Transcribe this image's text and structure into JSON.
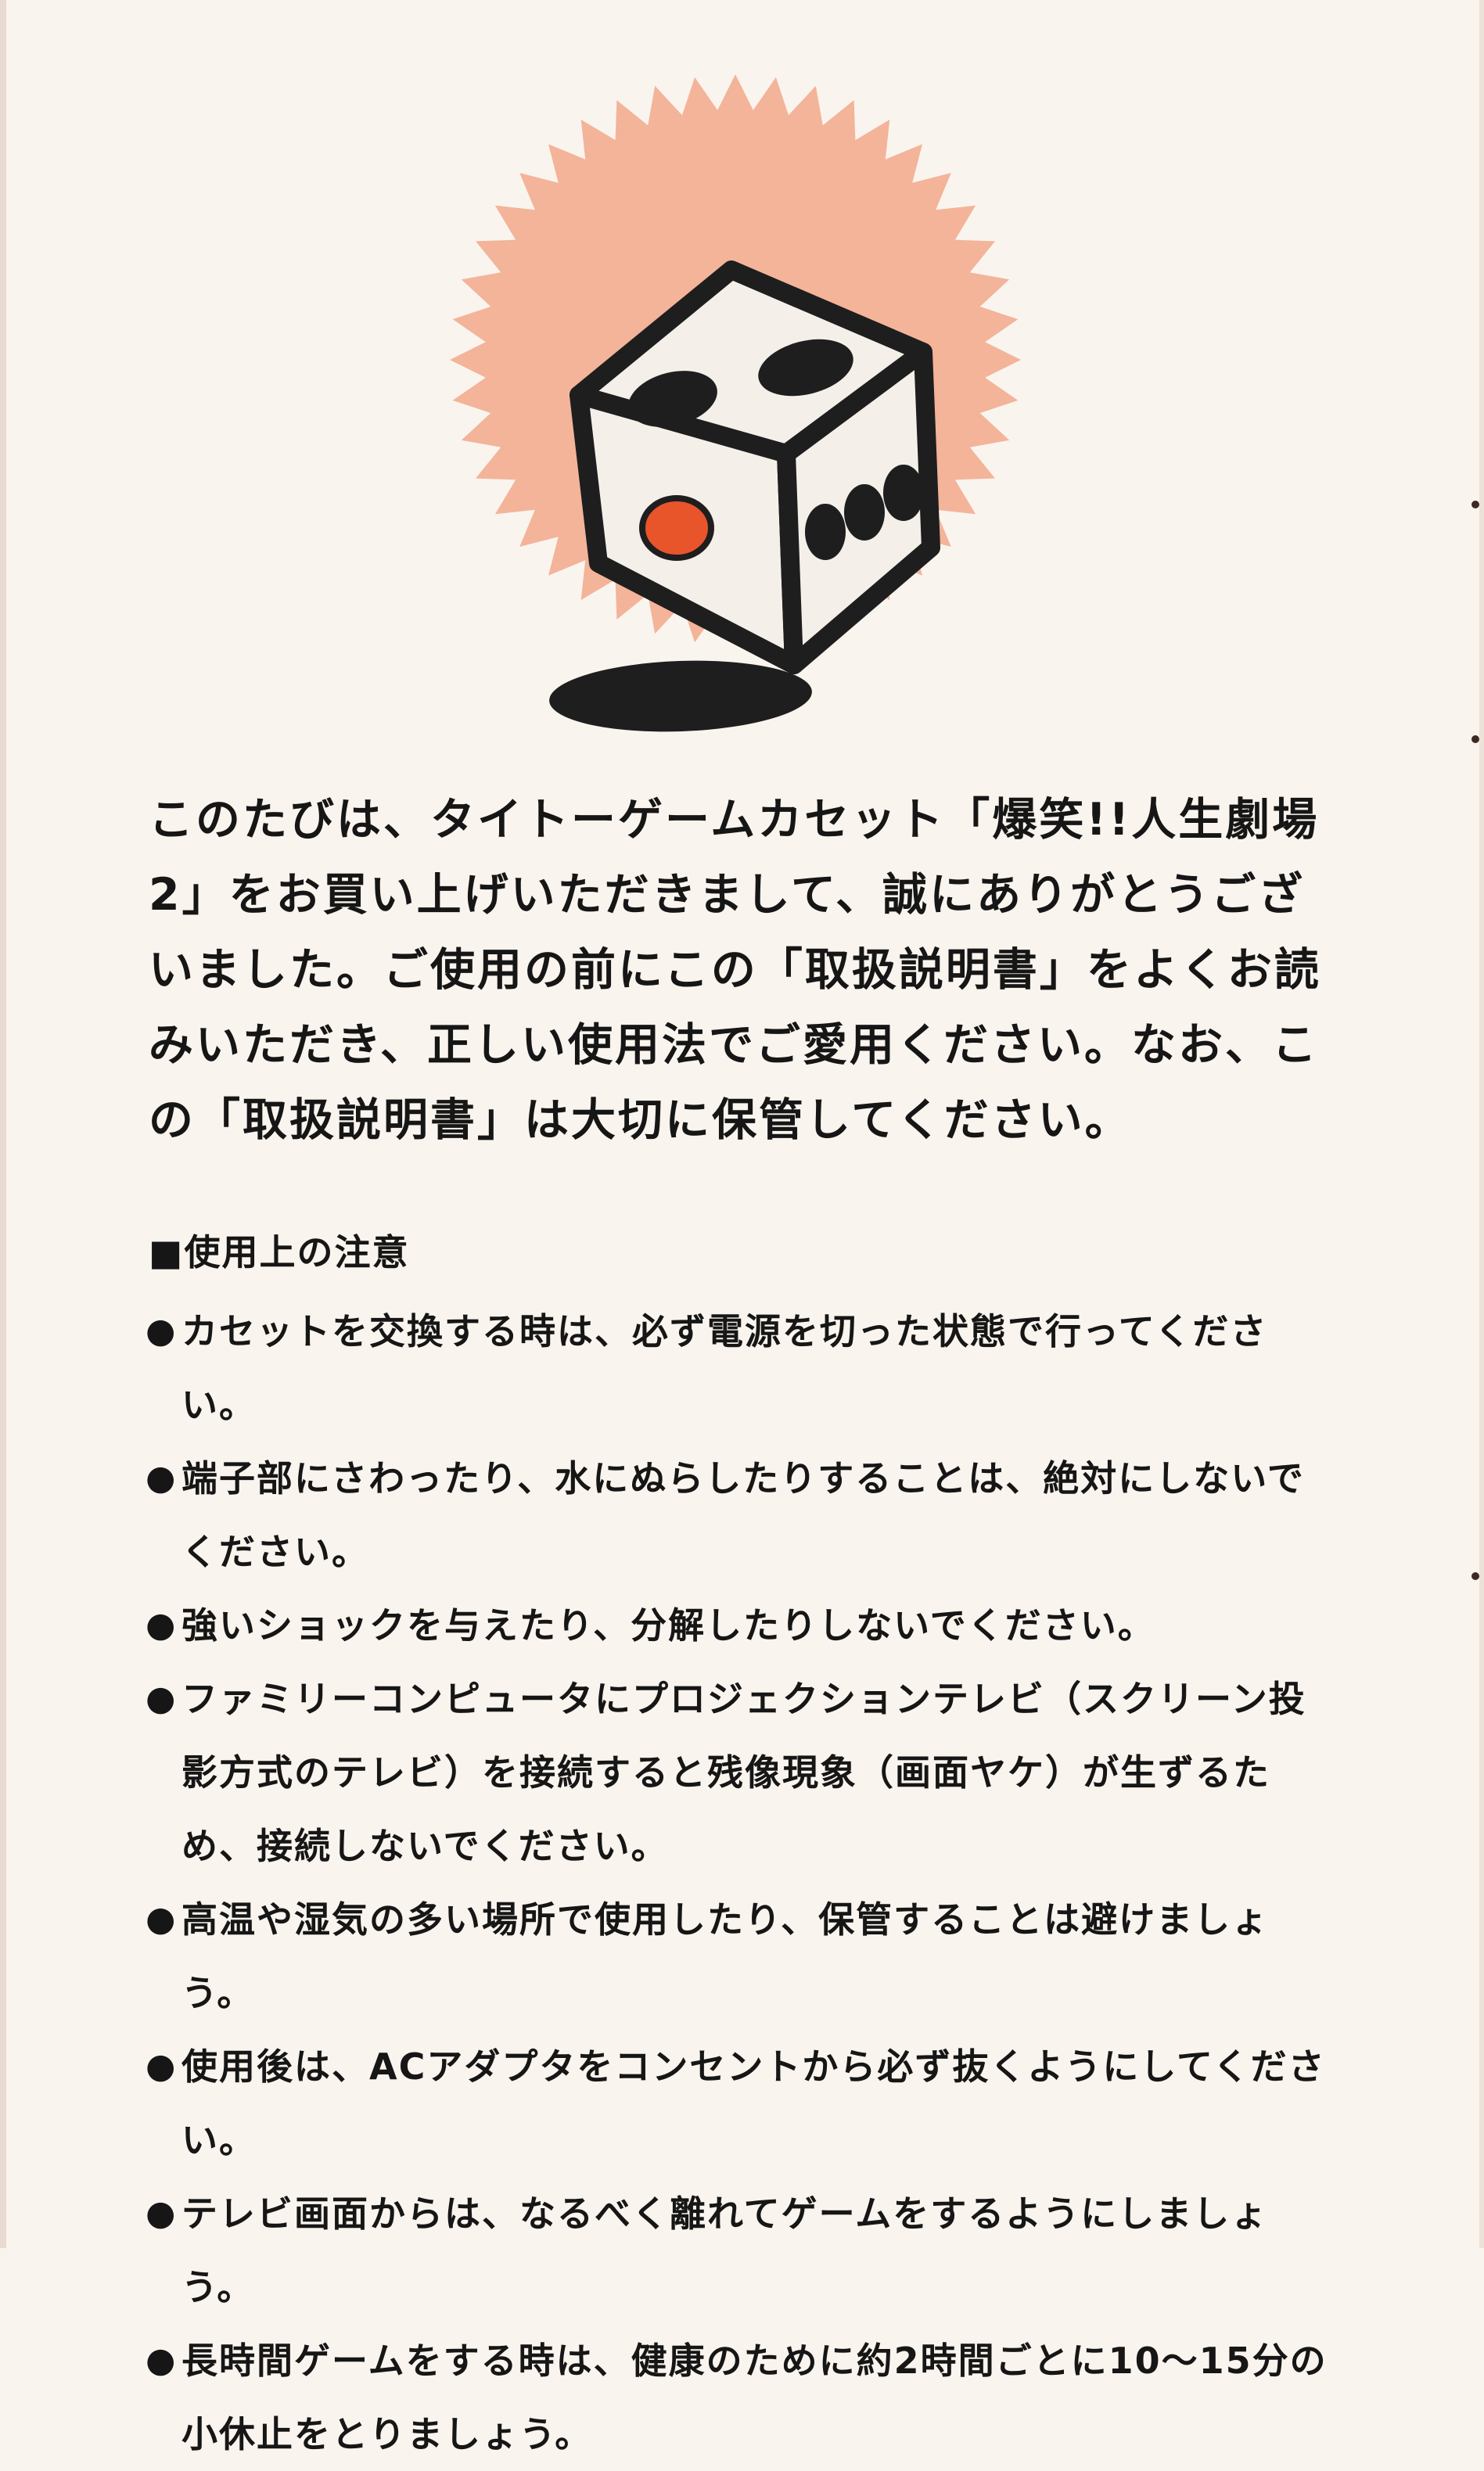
{
  "art": {
    "burst_color": "#f3b49a",
    "pip_accent_color": "#e8552a",
    "icon": "dice-icon"
  },
  "intro": {
    "text": "このたびは、タイトーゲームカセット「爆笑!!人生劇場2」をお買い上げいただきまして、誠にありがとうございました。ご使用の前にこの「取扱説明書」をよくお読みいただき、正しい使用法でご愛用ください。なお、この「取扱説明書」は大切に保管してください。"
  },
  "notes": {
    "title": "■使用上の注意",
    "items": [
      "カセットを交換する時は、必ず電源を切った状態で行ってください。",
      "端子部にさわったり、水にぬらしたりすることは、絶対にしないでください。",
      "強いショックを与えたり、分解したりしないでください。",
      "ファミリーコンピュータにプロジェクションテレビ（スクリーン投影方式のテレビ）を接続すると残像現象（画面ヤケ）が生ずるため、接続しないでください。",
      "高温や湿気の多い場所で使用したり、保管することは避けましょう。",
      "使用後は、ACアダプタをコンセントから必ず抜くようにしてください。",
      "テレビ画面からは、なるべく離れてゲームをするようにしましょう。",
      "長時間ゲームをする時は、健康のために約2時間ごとに10〜15分の小休止をとりましょう。"
    ]
  }
}
